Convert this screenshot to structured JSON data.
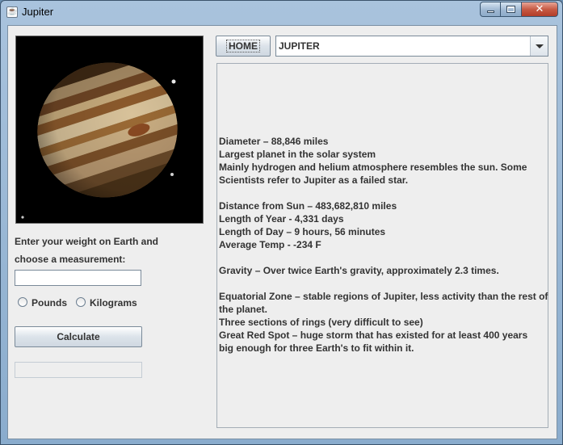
{
  "window": {
    "title": "Jupiter",
    "app_icon": "java-cup-icon",
    "controls": {
      "minimize_icon": "minimize-icon",
      "maximize_icon": "maximize-icon",
      "close_icon": "close-icon"
    }
  },
  "left_panel": {
    "image_alt_icon": "jupiter-image",
    "prompt_line1": "Enter your weight on Earth and",
    "prompt_line2": "choose a measurement:",
    "weight_input_value": "",
    "radio_pounds_label": "Pounds",
    "radio_kilograms_label": "Kilograms",
    "calculate_label": "Calculate",
    "result_value": ""
  },
  "header": {
    "home_label": "HOME",
    "planet_selected": "JUPITER"
  },
  "info": {
    "lines": [
      "Diameter – 88,846 miles",
      "Largest planet in the solar system",
      "Mainly hydrogen and helium atmosphere resembles the sun. Some",
      "Scientists refer to Jupiter as a failed star.",
      "",
      "Distance from Sun – 483,682,810 miles",
      "Length of Year - 4,331 days",
      "Length of Day – 9 hours, 56 minutes",
      "Average Temp - -234 F",
      "",
      "Gravity – Over twice Earth's gravity, approximately 2.3 times.",
      "",
      "Equatorial Zone – stable regions of Jupiter, less activity than the rest of",
      "the planet.",
      "Three sections of rings (very difficult to see)",
      "Great Red Spot – huge storm that has existed for at least 400 years",
      "big enough for three Earth's to fit within it."
    ]
  },
  "colors": {
    "window_frame": "#a9c3dd",
    "client_bg": "#eeeeee",
    "close_button": "#c75a44",
    "text": "#333333"
  }
}
